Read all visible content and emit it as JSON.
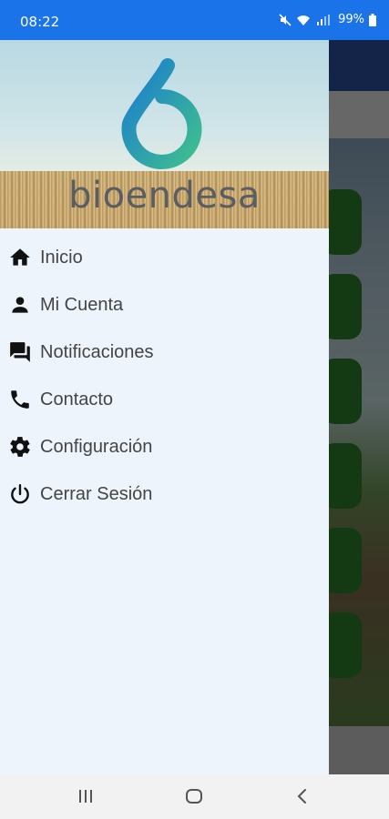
{
  "status_bar": {
    "time": "08:22",
    "battery": "99%",
    "icons": [
      "mute-icon",
      "wifi-icon",
      "signal-icon",
      "battery-icon"
    ]
  },
  "drawer": {
    "brand": "bioendesa",
    "menu": [
      {
        "label": "Inicio",
        "icon": "home-icon"
      },
      {
        "label": "Mi Cuenta",
        "icon": "person-icon"
      },
      {
        "label": "Notificaciones",
        "icon": "chat-icon"
      },
      {
        "label": "Contacto",
        "icon": "phone-icon"
      },
      {
        "label": "Configuración",
        "icon": "gear-icon"
      },
      {
        "label": "Cerrar Sesión",
        "icon": "power-icon"
      }
    ]
  },
  "nav_bar": {
    "buttons": [
      "recents-icon",
      "home-nav-icon",
      "back-icon"
    ]
  },
  "colors": {
    "status_bar": "#1a73e8",
    "drawer_bg": "#eef4fc",
    "logo_blue": "#1a7bd0",
    "logo_green": "#3fbf8f",
    "text": "#444444"
  }
}
